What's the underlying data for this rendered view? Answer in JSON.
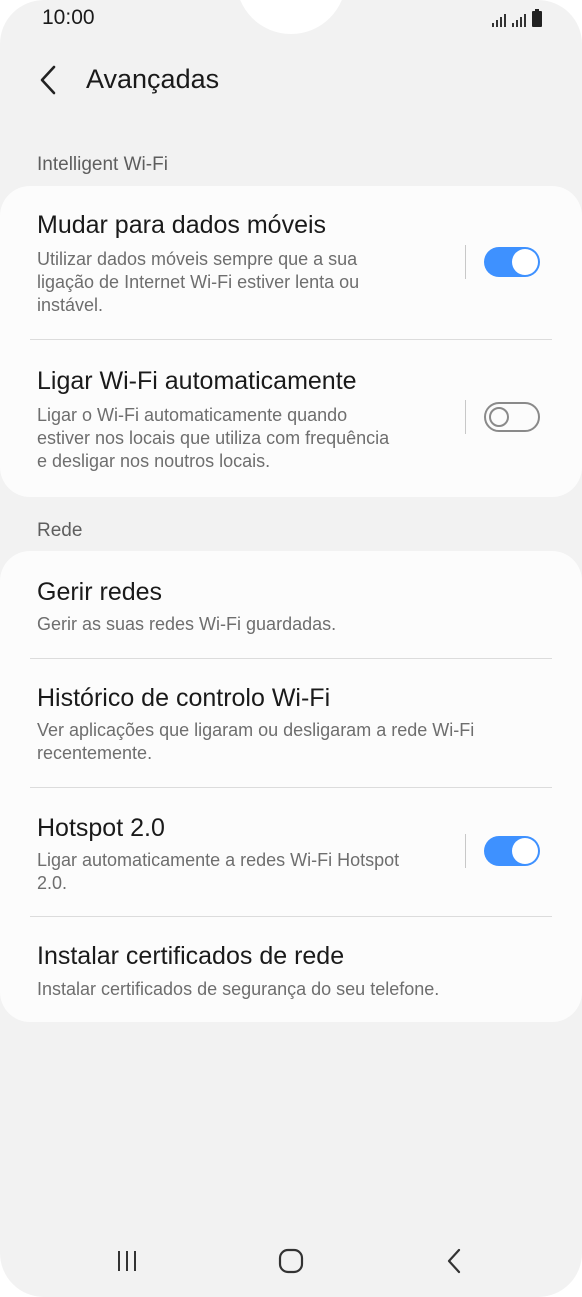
{
  "status": {
    "time": "10:00"
  },
  "header": {
    "title": "Avançadas"
  },
  "sections": {
    "intelligent_wifi": {
      "label": "Intelligent Wi-Fi"
    },
    "rede": {
      "label": "Rede"
    }
  },
  "items": {
    "mobile_data": {
      "title": "Mudar para dados móveis",
      "desc": [
        "Utilizar dados móveis sempre que a sua",
        "ligação de Internet Wi-Fi estiver lenta ou",
        "instável."
      ],
      "toggle": "on"
    },
    "auto_wifi": {
      "title": "Ligar Wi-Fi automaticamente",
      "desc": [
        "Ligar o Wi-Fi automaticamente quando",
        "estiver nos locais que utiliza com frequência",
        "e desligar nos noutros locais."
      ],
      "toggle": "off"
    },
    "manage_networks": {
      "title": "Gerir redes",
      "desc": [
        "Gerir as suas redes Wi-Fi guardadas."
      ]
    },
    "control_history": {
      "title": "Histórico de controlo Wi-Fi",
      "desc": [
        "Ver aplicações que ligaram ou desligaram a rede Wi-Fi",
        "recentemente."
      ]
    },
    "hotspot": {
      "title": "Hotspot 2.0",
      "desc": [
        "Ligar automaticamente a redes Wi-Fi Hotspot",
        "2.0."
      ],
      "toggle": "on"
    },
    "certificates": {
      "title": "Instalar certificados de rede",
      "desc": [
        "Instalar certificados de segurança do seu telefone."
      ]
    }
  },
  "colors": {
    "accent": "#3e91ff",
    "background": "#f2f2f2",
    "card": "#fcfcfc"
  },
  "icons": {
    "back": "chevron-left-icon",
    "recents": "recent-apps-icon",
    "home": "home-icon",
    "nav_back": "nav-back-icon"
  }
}
